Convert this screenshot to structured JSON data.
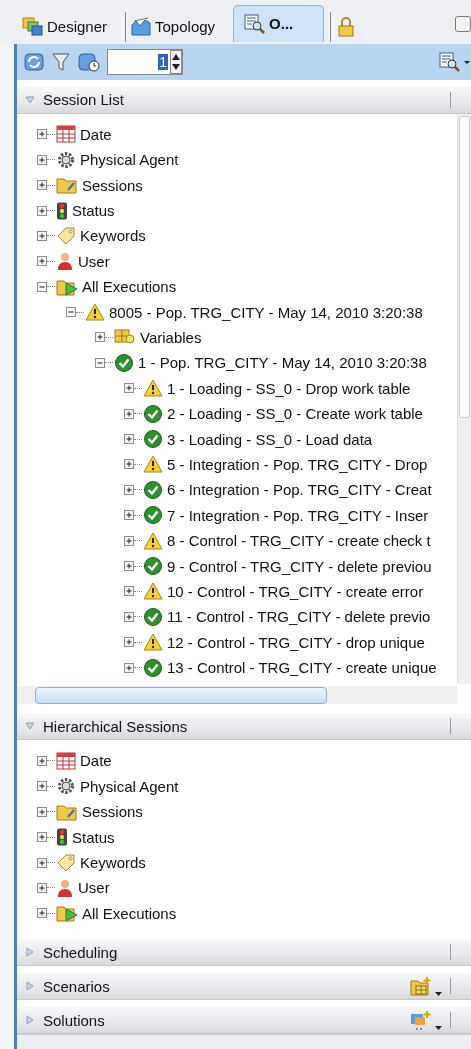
{
  "tabs": [
    {
      "label": "Designer",
      "kind": "designer",
      "selected": false
    },
    {
      "label": "Topology",
      "kind": "topology",
      "selected": false
    },
    {
      "label": "O...",
      "kind": "operator",
      "selected": true
    },
    {
      "kind": "security",
      "selected": false
    }
  ],
  "toolbar": {
    "spinner_value": "1"
  },
  "panels": [
    {
      "title": "Session List",
      "kind": "scrolling",
      "expanded": true,
      "tree": [
        {
          "label": "Date",
          "kind": "calendar",
          "expanded": false
        },
        {
          "label": "Physical Agent",
          "kind": "gear",
          "expanded": false
        },
        {
          "label": "Sessions",
          "kind": "folder",
          "expanded": false
        },
        {
          "label": "Status",
          "kind": "traffic-light",
          "expanded": false
        },
        {
          "label": "Keywords",
          "kind": "tag",
          "expanded": false
        },
        {
          "label": "User",
          "kind": "user",
          "expanded": false
        },
        {
          "label": "All Executions",
          "kind": "play-folder",
          "expanded": true,
          "children": [
            {
              "label": "8005 - Pop. TRG_CITY - May 14, 2010 3:20:38",
              "kind": "warning",
              "expanded": true,
              "children": [
                {
                  "label": "Variables",
                  "kind": "variables",
                  "expanded": false
                },
                {
                  "label": "1 - Pop. TRG_CITY - May 14, 2010 3:20:38",
                  "kind": "success",
                  "expanded": true,
                  "children": [
                    {
                      "label": "1 - Loading - SS_0 - Drop work table",
                      "kind": "warning",
                      "expanded": false
                    },
                    {
                      "label": "2 - Loading - SS_0 - Create work table",
                      "kind": "success",
                      "expanded": false
                    },
                    {
                      "label": "3 - Loading - SS_0 - Load data",
                      "kind": "success",
                      "expanded": false
                    },
                    {
                      "label": "5 - Integration - Pop. TRG_CITY - Drop",
                      "kind": "warning",
                      "expanded": false
                    },
                    {
                      "label": "6 - Integration - Pop. TRG_CITY - Creat",
                      "kind": "success",
                      "expanded": false
                    },
                    {
                      "label": "7 - Integration - Pop. TRG_CITY - Inser",
                      "kind": "success",
                      "expanded": false
                    },
                    {
                      "label": "8 - Control - TRG_CITY - create check t",
                      "kind": "warning",
                      "expanded": false
                    },
                    {
                      "label": "9 - Control - TRG_CITY - delete previou",
                      "kind": "success",
                      "expanded": false
                    },
                    {
                      "label": "10 - Control - TRG_CITY - create error",
                      "kind": "warning",
                      "expanded": false
                    },
                    {
                      "label": "11 - Control - TRG_CITY - delete previo",
                      "kind": "success",
                      "expanded": false
                    },
                    {
                      "label": "12 - Control - TRG_CITY - drop unique",
                      "kind": "warning",
                      "expanded": false
                    },
                    {
                      "label": "13 - Control - TRG_CITY - create unique",
                      "kind": "success",
                      "expanded": false
                    }
                  ]
                }
              ]
            }
          ]
        }
      ]
    },
    {
      "title": "Hierarchical Sessions",
      "kind": "plain",
      "expanded": true,
      "tree": [
        {
          "label": "Date",
          "kind": "calendar",
          "expanded": false
        },
        {
          "label": "Physical Agent",
          "kind": "gear",
          "expanded": false
        },
        {
          "label": "Sessions",
          "kind": "folder",
          "expanded": false
        },
        {
          "label": "Status",
          "kind": "traffic-light",
          "expanded": false
        },
        {
          "label": "Keywords",
          "kind": "tag",
          "expanded": false
        },
        {
          "label": "User",
          "kind": "user",
          "expanded": false
        },
        {
          "label": "All Executions",
          "kind": "play-folder",
          "expanded": false
        }
      ]
    },
    {
      "title": "Scheduling",
      "kind": "plain",
      "expanded": false
    },
    {
      "title": "Scenarios",
      "kind": "scenario",
      "expanded": false
    },
    {
      "title": "Solutions",
      "kind": "solution",
      "expanded": false
    }
  ]
}
